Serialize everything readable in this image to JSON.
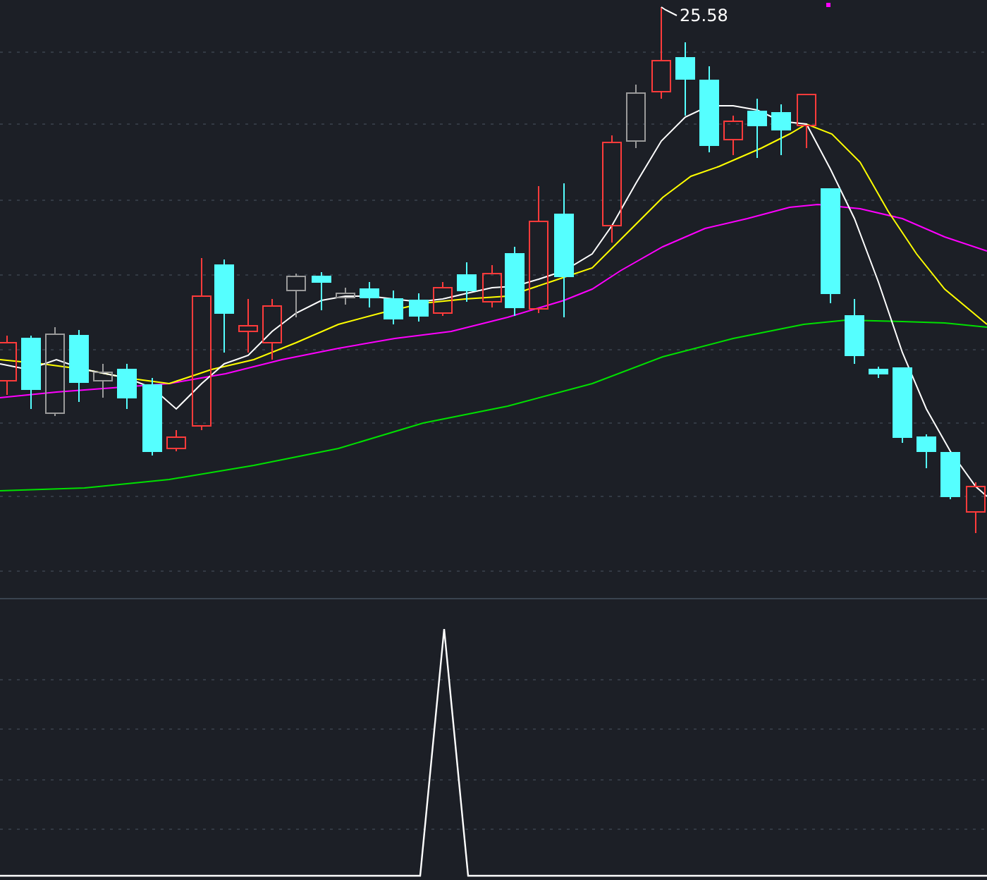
{
  "price_chart": {
    "high_label": "25.58"
  }
}
